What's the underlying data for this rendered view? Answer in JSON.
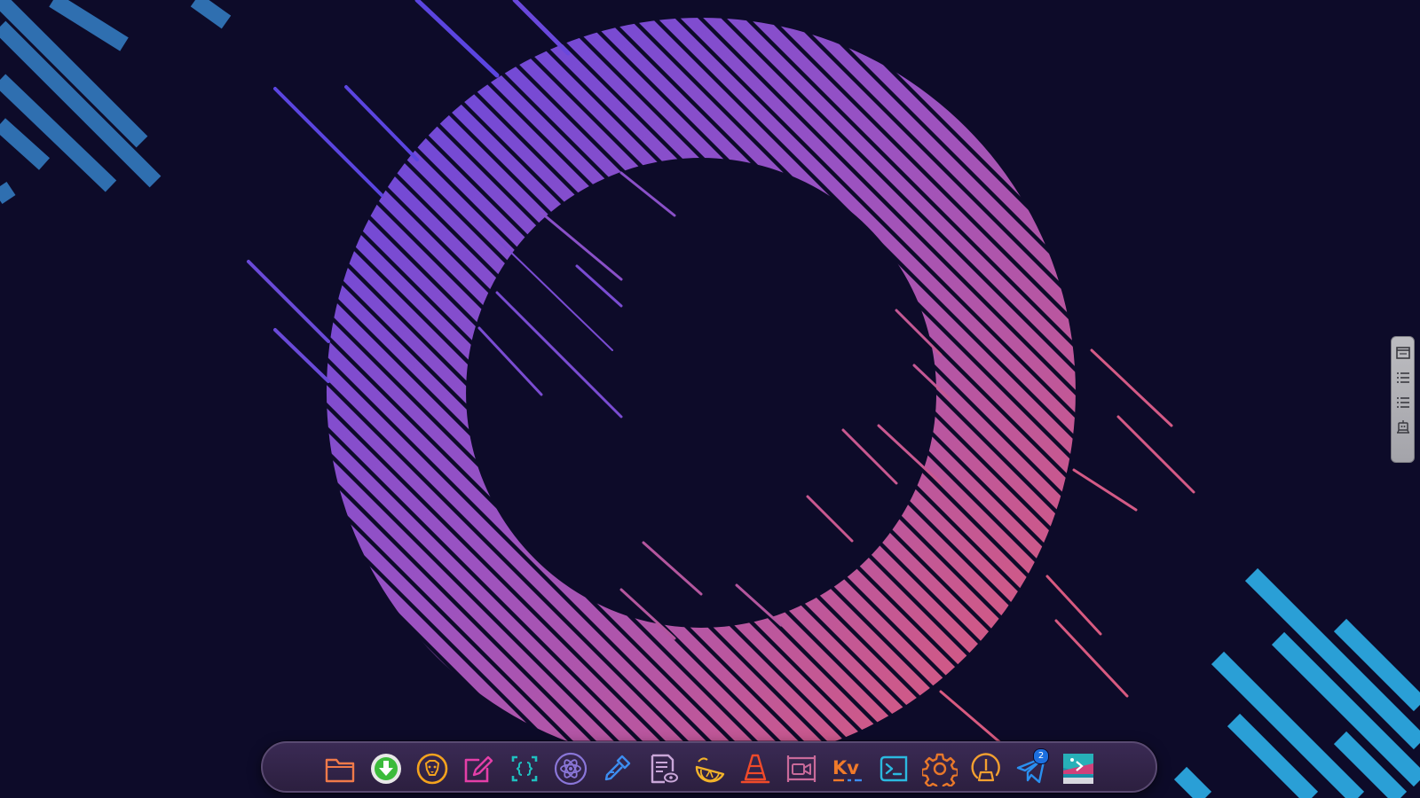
{
  "desktop": {
    "background_color": "#0d0b29",
    "ring_gradient": [
      "#6b47d9",
      "#9550c4",
      "#d45a8e",
      "#e25a78"
    ],
    "blue_stripes_color": "#2f6fb0",
    "cyan_stripes_color": "#2a9fd6"
  },
  "dock": {
    "items": [
      {
        "name": "file-manager",
        "icon": "folder-icon"
      },
      {
        "name": "downloader",
        "icon": "download-arrow-icon"
      },
      {
        "name": "brave-browser",
        "icon": "lion-icon"
      },
      {
        "name": "text-editor",
        "icon": "pencil-square-icon"
      },
      {
        "name": "code-editor",
        "icon": "braces-icon"
      },
      {
        "name": "atom-app",
        "icon": "atom-icon"
      },
      {
        "name": "color-picker",
        "icon": "eyedropper-icon"
      },
      {
        "name": "document-viewer",
        "icon": "document-eye-icon"
      },
      {
        "name": "citrus-app",
        "icon": "lemon-icon"
      },
      {
        "name": "vlc-player",
        "icon": "traffic-cone-icon"
      },
      {
        "name": "screen-recorder",
        "icon": "video-camera-icon"
      },
      {
        "name": "kv-editor",
        "icon": "kv-icon",
        "label": "Kv"
      },
      {
        "name": "terminal",
        "icon": "terminal-icon"
      },
      {
        "name": "settings",
        "icon": "gear-icon"
      },
      {
        "name": "cleaner",
        "icon": "broom-icon"
      },
      {
        "name": "telegram",
        "icon": "paper-plane-icon",
        "badge": "2"
      },
      {
        "name": "screenshot-tool",
        "icon": "screenshot-image-icon"
      }
    ]
  },
  "side_panel": {
    "buttons": [
      {
        "name": "window-layout",
        "icon": "window-icon"
      },
      {
        "name": "list-a",
        "icon": "list-icon"
      },
      {
        "name": "list-b",
        "icon": "list-icon"
      },
      {
        "name": "robot",
        "icon": "robot-icon"
      }
    ]
  }
}
